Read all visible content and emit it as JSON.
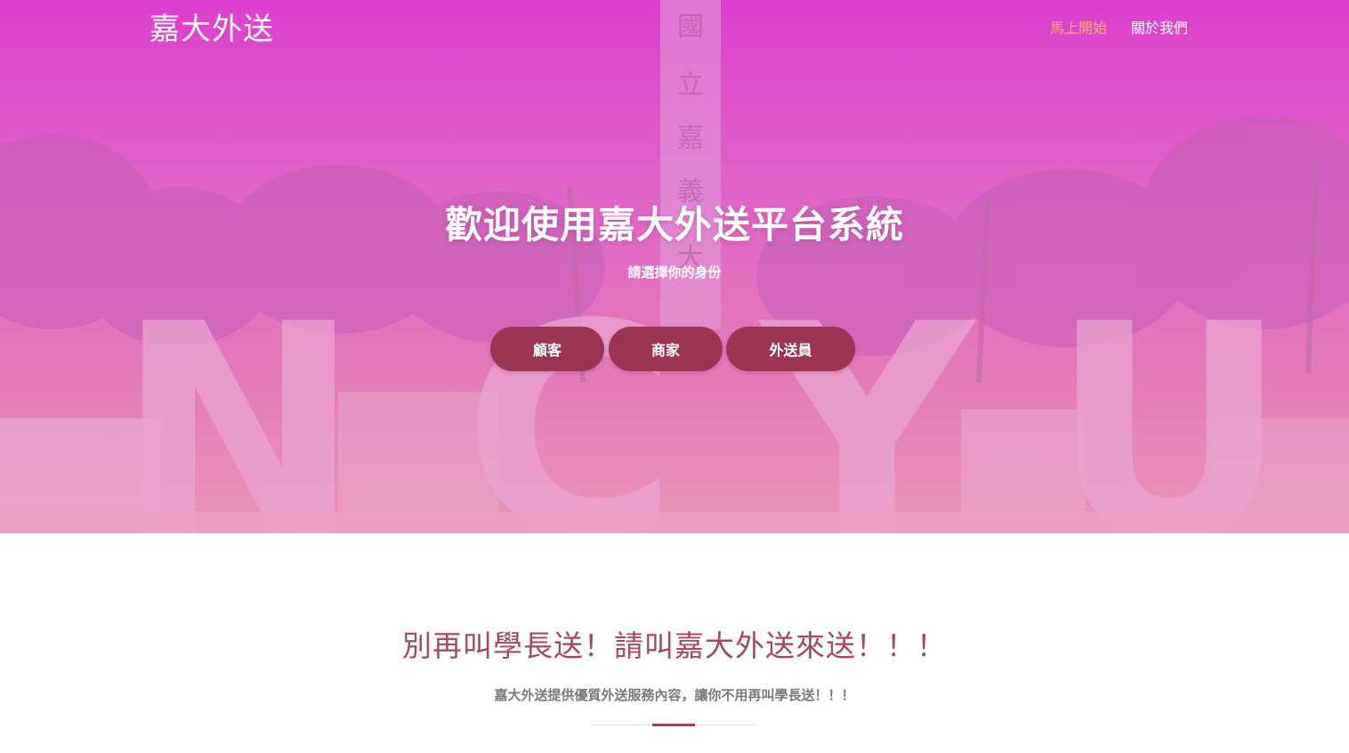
{
  "navbar": {
    "brand": "嘉大外送",
    "links": [
      {
        "label": "馬上開始",
        "active": true
      },
      {
        "label": "關於我們",
        "active": false
      }
    ]
  },
  "hero": {
    "title": "歡迎使用嘉大外送平台系統",
    "subtitle": "請選擇你的身份",
    "roles": [
      {
        "label": "顧客"
      },
      {
        "label": "商家"
      },
      {
        "label": "外送員"
      }
    ],
    "background_image": {
      "description_name": "campus-entrance-photo",
      "sign_letters": [
        "N",
        "C",
        "Y",
        "U"
      ],
      "monument_text": "國立嘉義大學"
    }
  },
  "intro": {
    "heading": "別再叫學長送！請叫嘉大外送來送！！！",
    "text": "嘉大外送提供優質外送服務內容，讓你不用再叫學長送！！！"
  },
  "colors": {
    "hero_gradient_top": "#dc3fcf",
    "hero_gradient_bottom": "#ea95b7",
    "button_bg": "#9b3553",
    "nav_active": "#f3b35e",
    "heading_accent": "#a8495e",
    "divider_accent": "#b23a4f"
  }
}
